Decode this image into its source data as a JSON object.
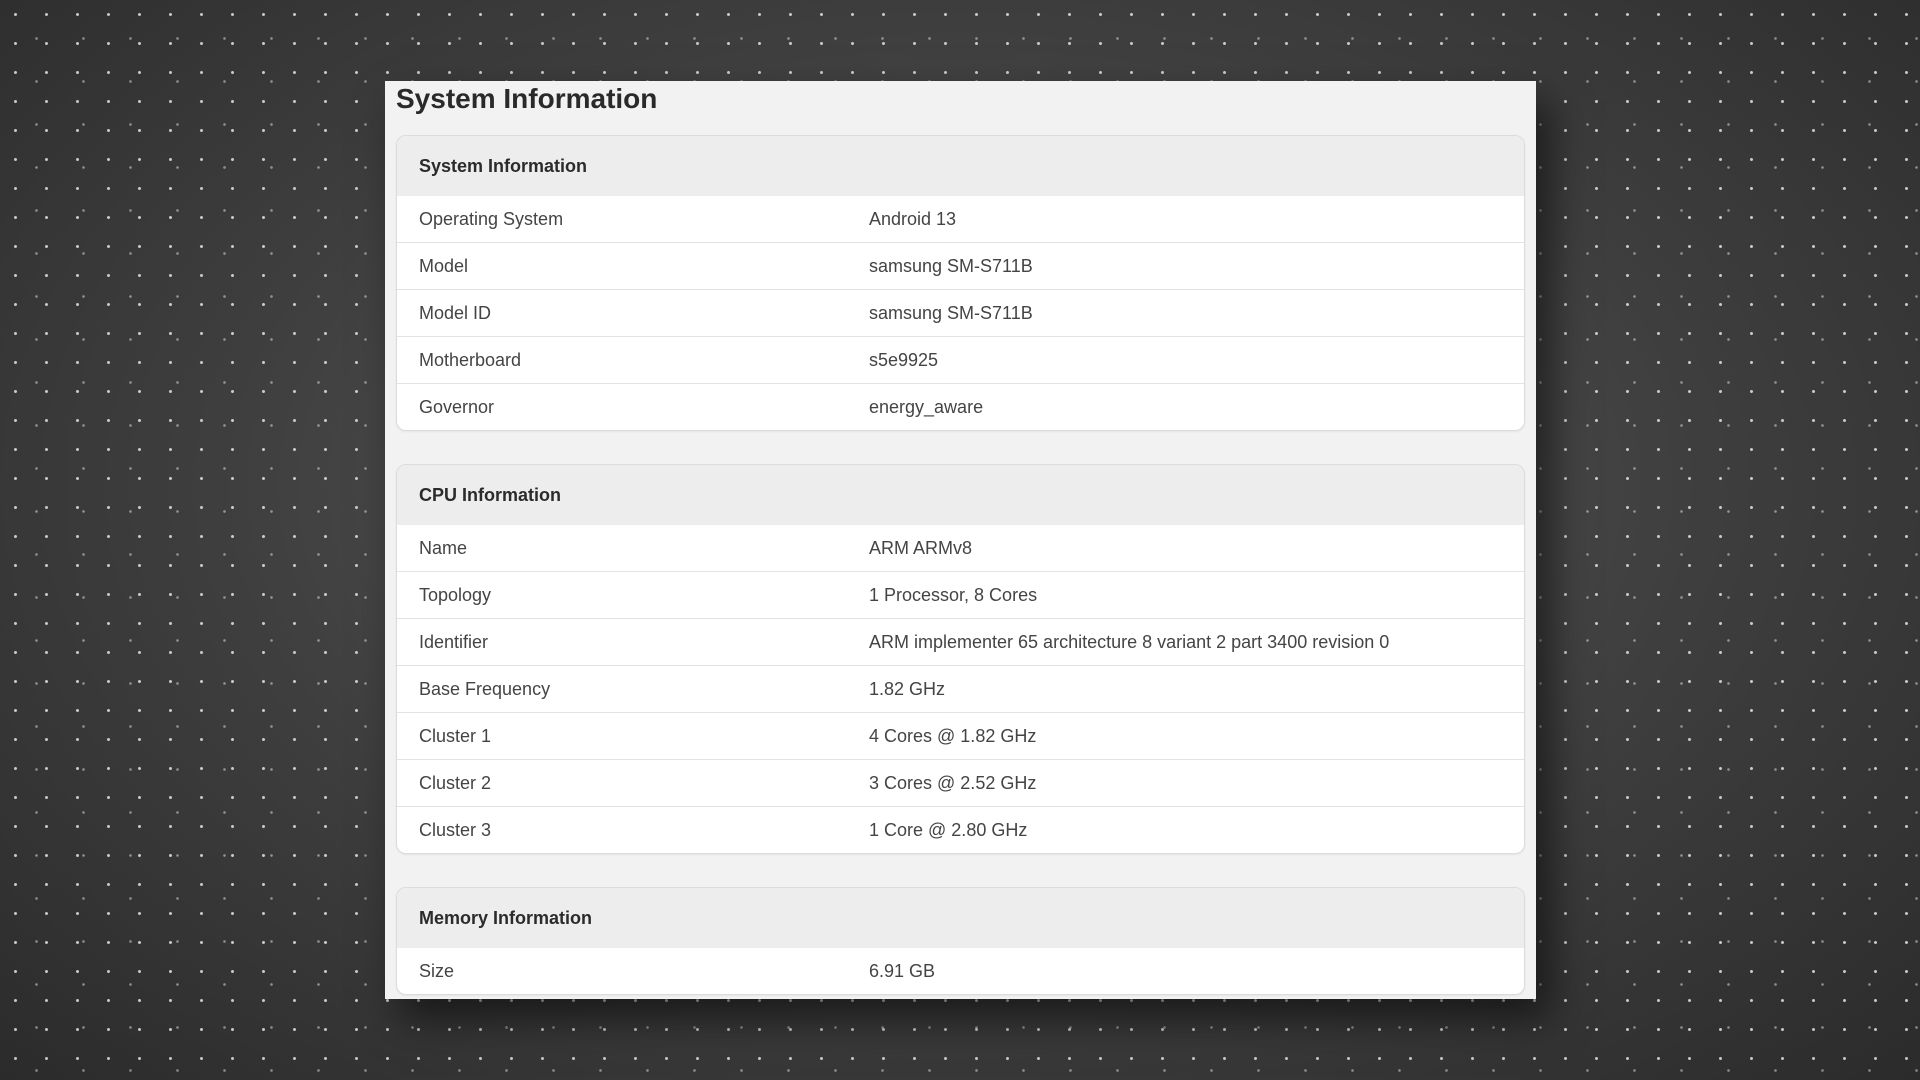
{
  "page": {
    "title": "System Information"
  },
  "sections": [
    {
      "title": "System Information",
      "rows": [
        {
          "label": "Operating System",
          "value": "Android 13"
        },
        {
          "label": "Model",
          "value": "samsung SM-S711B"
        },
        {
          "label": "Model ID",
          "value": "samsung SM-S711B"
        },
        {
          "label": "Motherboard",
          "value": "s5e9925"
        },
        {
          "label": "Governor",
          "value": "energy_aware"
        }
      ]
    },
    {
      "title": "CPU Information",
      "rows": [
        {
          "label": "Name",
          "value": "ARM ARMv8"
        },
        {
          "label": "Topology",
          "value": "1 Processor, 8 Cores"
        },
        {
          "label": "Identifier",
          "value": "ARM implementer 65 architecture 8 variant 2 part 3400 revision 0"
        },
        {
          "label": "Base Frequency",
          "value": "1.82 GHz"
        },
        {
          "label": "Cluster 1",
          "value": "4 Cores @ 1.82 GHz"
        },
        {
          "label": "Cluster 2",
          "value": "3 Cores @ 2.52 GHz"
        },
        {
          "label": "Cluster 3",
          "value": "1 Core @ 2.80 GHz"
        }
      ]
    },
    {
      "title": "Memory Information",
      "rows": [
        {
          "label": "Size",
          "value": "6.91 GB"
        }
      ]
    }
  ],
  "colors": {
    "panel_background": "#f2f2f2",
    "section_header_background": "#ededed",
    "row_background": "#ffffff",
    "text": "#444444",
    "heading": "#2a2a2a"
  }
}
